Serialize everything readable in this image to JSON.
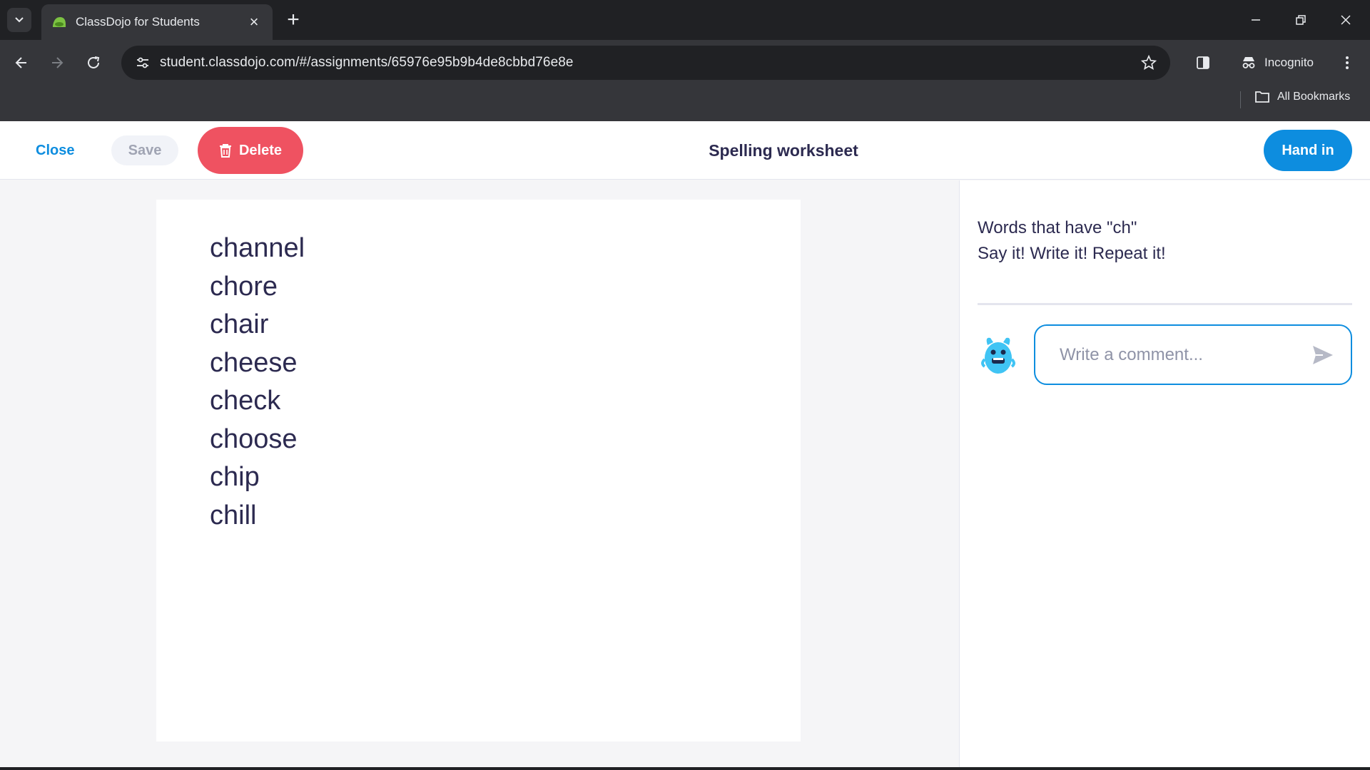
{
  "browser": {
    "tab_title": "ClassDojo for Students",
    "url": "student.classdojo.com/#/assignments/65976e95b9b4de8cbbd76e8e",
    "incognito_label": "Incognito",
    "bookmarks_label": "All Bookmarks"
  },
  "header": {
    "close_label": "Close",
    "save_label": "Save",
    "delete_label": "Delete",
    "title": "Spelling worksheet",
    "hand_in_label": "Hand in"
  },
  "worksheet": {
    "words": [
      "channel",
      "chore",
      "chair",
      "cheese",
      "check",
      "choose",
      "chip",
      "chill"
    ]
  },
  "sidebar": {
    "description_line1": "Words that have \"ch\"",
    "description_line2": "Say it! Write it! Repeat it!",
    "comment_placeholder": "Write a comment..."
  },
  "colors": {
    "accent": "#0d8ddf",
    "delete": "#ef5261",
    "avatar": "#40c4f4"
  },
  "icons": {
    "favicon": "classdojo-favicon",
    "delete": "trash-icon",
    "send": "send-icon",
    "avatar": "monster-avatar"
  }
}
